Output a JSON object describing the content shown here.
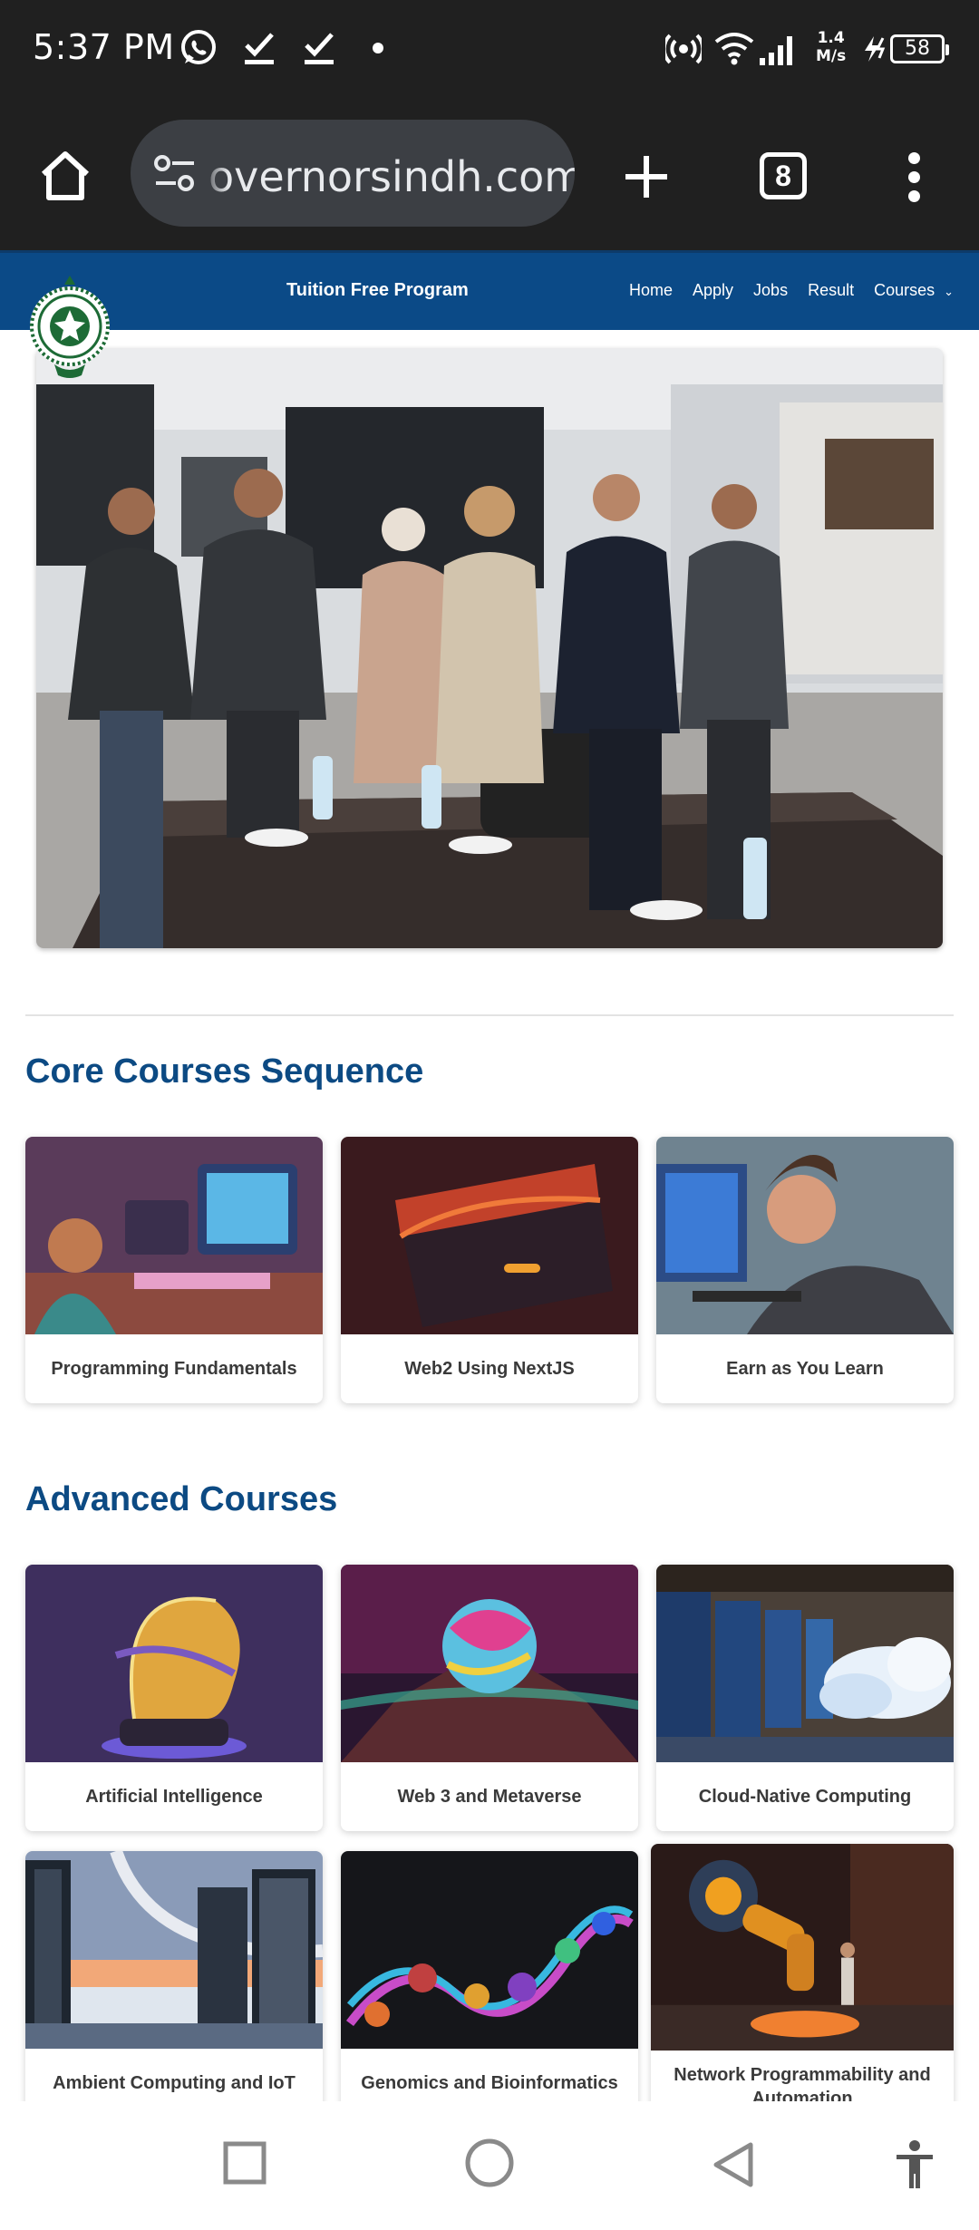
{
  "status_bar": {
    "time": "5:37 PM",
    "speed_value": "1.4",
    "speed_unit": "M/s",
    "battery": "58",
    "icons": [
      "whatsapp-icon",
      "check-icon",
      "check-icon",
      "dot-icon",
      "hotspot-icon",
      "wifi-icon",
      "signal-icon",
      "charging-icon",
      "battery-icon"
    ]
  },
  "browser": {
    "url": "overnorsindh.com",
    "tab_count": "8",
    "icons": [
      "home-icon",
      "site-settings-icon",
      "new-tab-icon",
      "tab-switcher-icon",
      "more-vert-icon"
    ]
  },
  "site_nav": {
    "title": "Tuition Free Program",
    "links": [
      "Home",
      "Apply",
      "Jobs",
      "Result",
      "Courses"
    ],
    "courses_chevron": "⌄"
  },
  "sections": {
    "core": {
      "title": "Core Courses Sequence",
      "cards": [
        "Programming Fundamentals",
        "Web2 Using NextJS",
        "Earn as You Learn"
      ]
    },
    "advanced": {
      "title": "Advanced Courses",
      "cards": [
        "Artificial Intelligence",
        "Web 3 and Metaverse",
        "Cloud-Native Computing",
        "Ambient Computing and IoT",
        "Genomics and Bioinformatics",
        "Network Programmability and Automation"
      ]
    }
  },
  "colors": {
    "nav_blue": "#0b4a87",
    "heading_blue": "#0c4a83",
    "chrome_dark": "#202020"
  }
}
